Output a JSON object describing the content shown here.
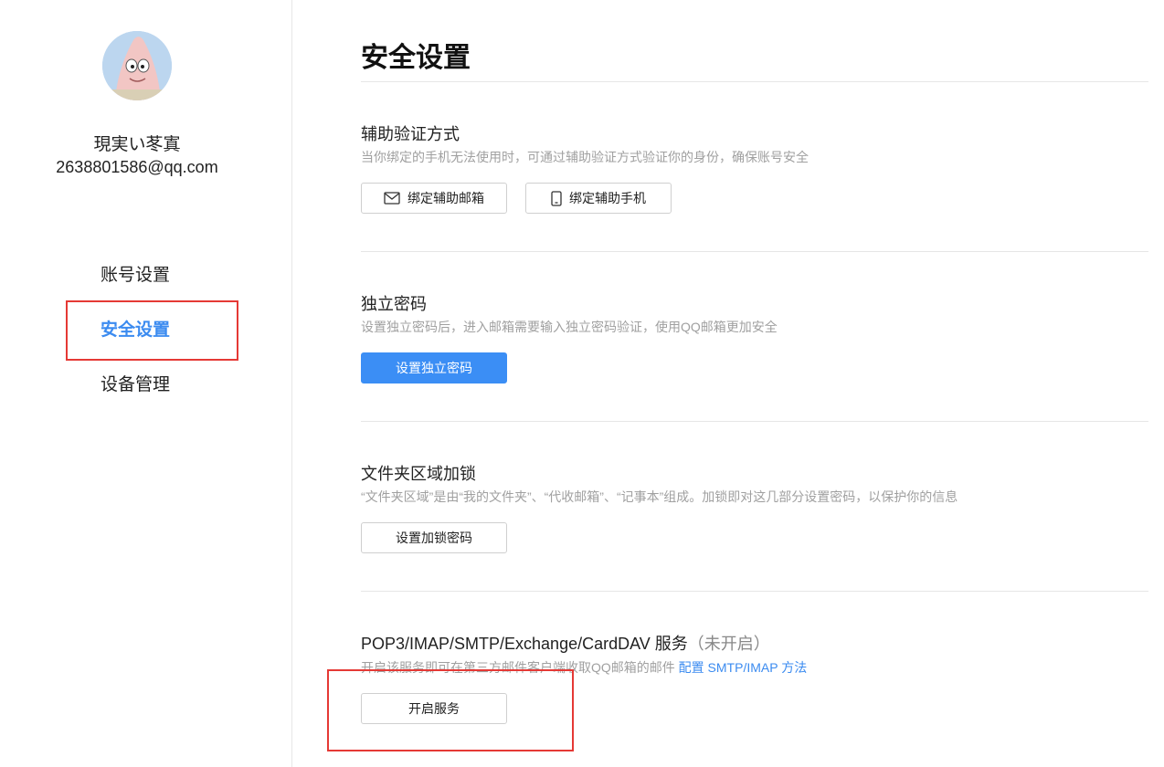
{
  "user": {
    "name": "現実い苳寘",
    "email": "2638801586@qq.com"
  },
  "nav": {
    "items": [
      {
        "label": "账号设置",
        "active": false
      },
      {
        "label": "安全设置",
        "active": true
      },
      {
        "label": "设备管理",
        "active": false
      }
    ]
  },
  "page": {
    "title": "安全设置"
  },
  "sections": {
    "aux": {
      "title": "辅助验证方式",
      "desc": "当你绑定的手机无法使用时，可通过辅助验证方式验证你的身份，确保账号安全",
      "btn_email": "绑定辅助邮箱",
      "btn_phone": "绑定辅助手机",
      "icon_email": "mail-icon",
      "icon_phone": "phone-icon"
    },
    "password": {
      "title": "独立密码",
      "desc": "设置独立密码后，进入邮箱需要输入独立密码验证，使用QQ邮箱更加安全",
      "btn": "设置独立密码"
    },
    "folder": {
      "title": "文件夹区域加锁",
      "desc": "“文件夹区域”是由“我的文件夹”、“代收邮箱”、“记事本”组成。加锁即对这几部分设置密码，以保护你的信息",
      "btn": "设置加锁密码"
    },
    "pop3": {
      "title": "POP3/IMAP/SMTP/Exchange/CardDAV 服务",
      "status": "（未开启）",
      "desc": "开启该服务即可在第三方邮件客户端收取QQ邮箱的邮件",
      "link": "配置 SMTP/IMAP 方法",
      "btn": "开启服务"
    }
  },
  "colors": {
    "accent": "#3b8bf0",
    "primary_button": "#3b8ef5",
    "highlight_box": "#e53935"
  }
}
